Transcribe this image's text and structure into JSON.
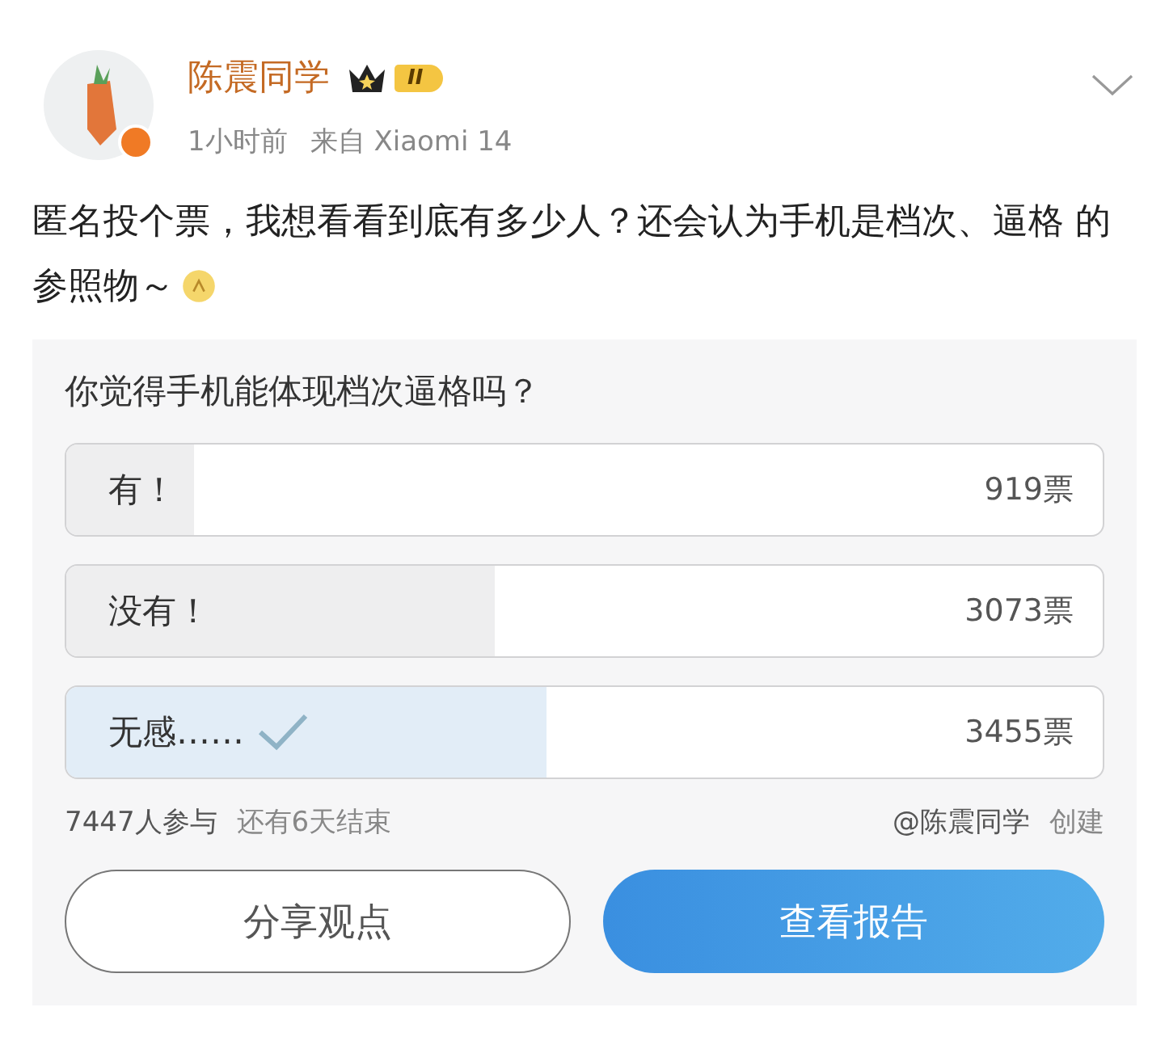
{
  "post": {
    "author": "陈震同学",
    "level_badge": "II",
    "time": "1小时前",
    "source": "来自 Xiaomi 14",
    "text": "匿名投个票，我想看看到底有多少人？还会认为手机是档次、逼格 的参照物～"
  },
  "poll": {
    "question": "你觉得手机能体现档次逼格吗？",
    "options": [
      {
        "label": "有！",
        "votes": "919票",
        "level": 0.123,
        "selected": false
      },
      {
        "label": "没有！",
        "votes": "3073票",
        "level": 0.413,
        "selected": false
      },
      {
        "label": "无感……",
        "votes": "3455票",
        "level": 0.464,
        "selected": true
      }
    ],
    "participants": "7447人参与",
    "remaining": "还有6天结束",
    "creator": "@陈震同学",
    "created": "创建",
    "buttons": [
      {
        "label": "分享观点",
        "kind": "outline"
      },
      {
        "label": "查看报告",
        "kind": "primary"
      }
    ]
  }
}
